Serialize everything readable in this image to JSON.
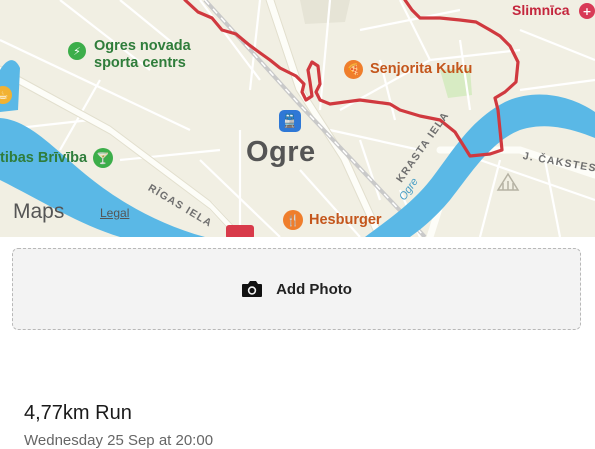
{
  "map": {
    "pois": {
      "ogres_novada": "Ogres novada\nsporta centrs",
      "brivibas": "tibas Brīvība",
      "senjorita": "Senjorita Kuku",
      "hesburger": "Hesburger",
      "slimnica": "Slimnīca"
    },
    "city_label": "Ogre",
    "streets": {
      "rigas": "RĪGAS IELA",
      "krasta": "KRASTA IELA",
      "cakstes": "J. ČAKSTES"
    },
    "river_label": "Ogre",
    "brand": "Maps",
    "legal": "Legal",
    "colors": {
      "route": "#d0393f",
      "river": "#5ab8e6",
      "land": "#f1efe3",
      "park": "#cfe7b9"
    }
  },
  "add_photo": {
    "label": "Add Photo",
    "icon": "camera-icon"
  },
  "activity": {
    "title": "4,77km Run",
    "date": "Wednesday 25 Sep at 20:00"
  }
}
